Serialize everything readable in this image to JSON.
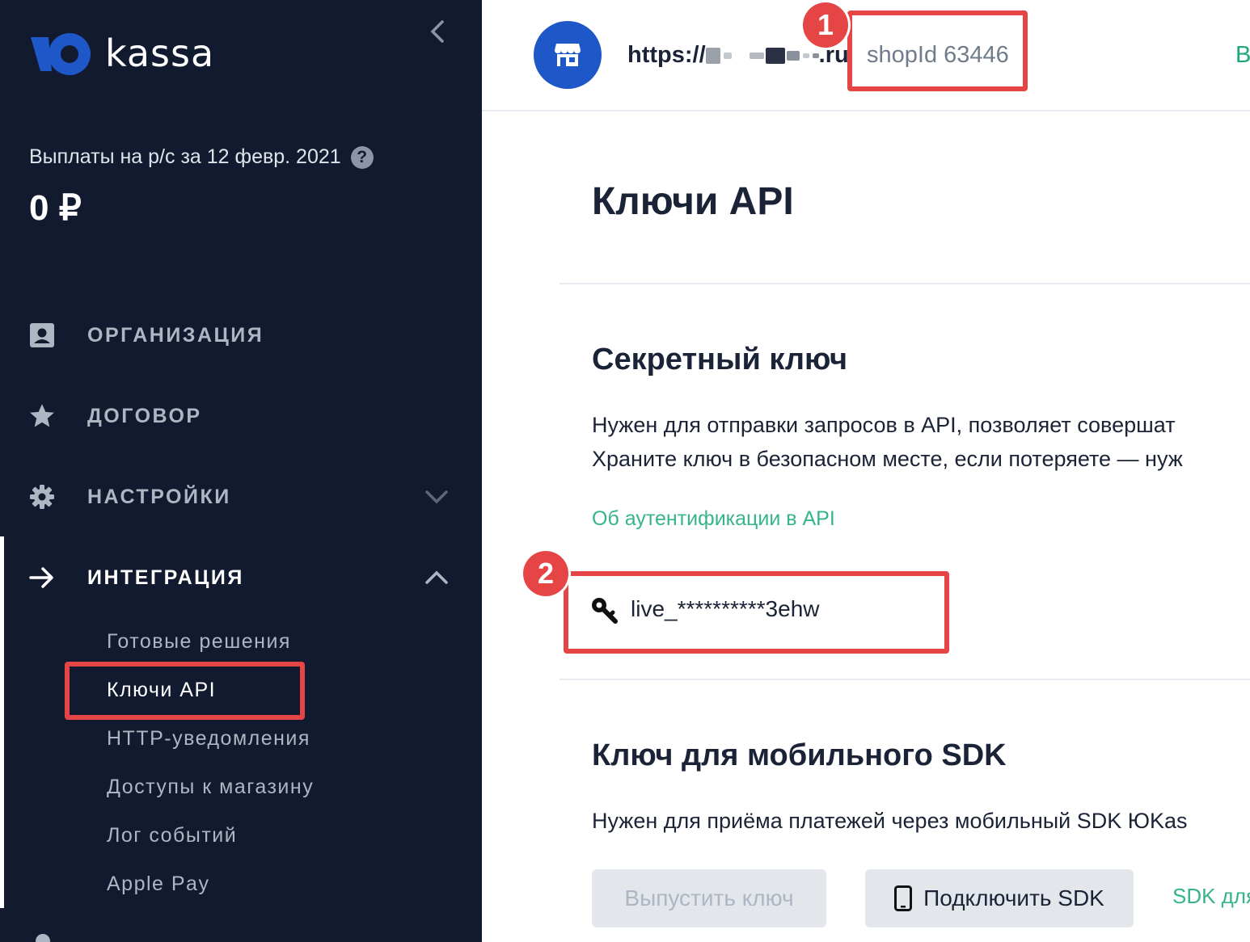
{
  "sidebar": {
    "logo_text": "kassa",
    "payout_label": "Выплаты на р/с за 12 февр. 2021",
    "payout_amount": "0 ₽",
    "nav": [
      {
        "label": "ОРГАНИЗАЦИЯ",
        "icon": "id-card-icon"
      },
      {
        "label": "ДОГОВОР",
        "icon": "star-icon"
      },
      {
        "label": "НАСТРОЙКИ",
        "icon": "gear-icon"
      },
      {
        "label": "ИНТЕГРАЦИЯ",
        "icon": "arrow-right-icon"
      }
    ],
    "integration_items": [
      "Готовые решения",
      "Ключи API",
      "HTTP-уведомления",
      "Доступы к магазину",
      "Лог событий",
      "Apple Pay"
    ]
  },
  "header": {
    "shop_url_prefix": "https://",
    "shop_url_suffix": ".ru",
    "shop_id": "shopId 63446",
    "right_partial": "В"
  },
  "main": {
    "title": "Ключи API",
    "secret": {
      "title": "Секретный ключ",
      "desc_line1": "Нужен для отправки запросов в API, позволяет совершат",
      "desc_line2": "Храните ключ в безопасном месте, если потеряете — нуж",
      "link": "Об аутентификации в API",
      "key_value": "live_**********3ehw"
    },
    "sdk": {
      "title": "Ключ для мобильного SDK",
      "desc": "Нужен для приёма платежей через мобильный SDK ЮKas",
      "issue_button": "Выпустить ключ",
      "connect_button": "Подключить SDK",
      "link_partial": "SDK для"
    }
  },
  "annotations": {
    "badge1": "1",
    "badge2": "2"
  },
  "colors": {
    "sidebar_bg": "#111a2e",
    "accent_blue": "#1e57c8",
    "highlight_red": "#e64545",
    "link_green": "#36b48a"
  }
}
